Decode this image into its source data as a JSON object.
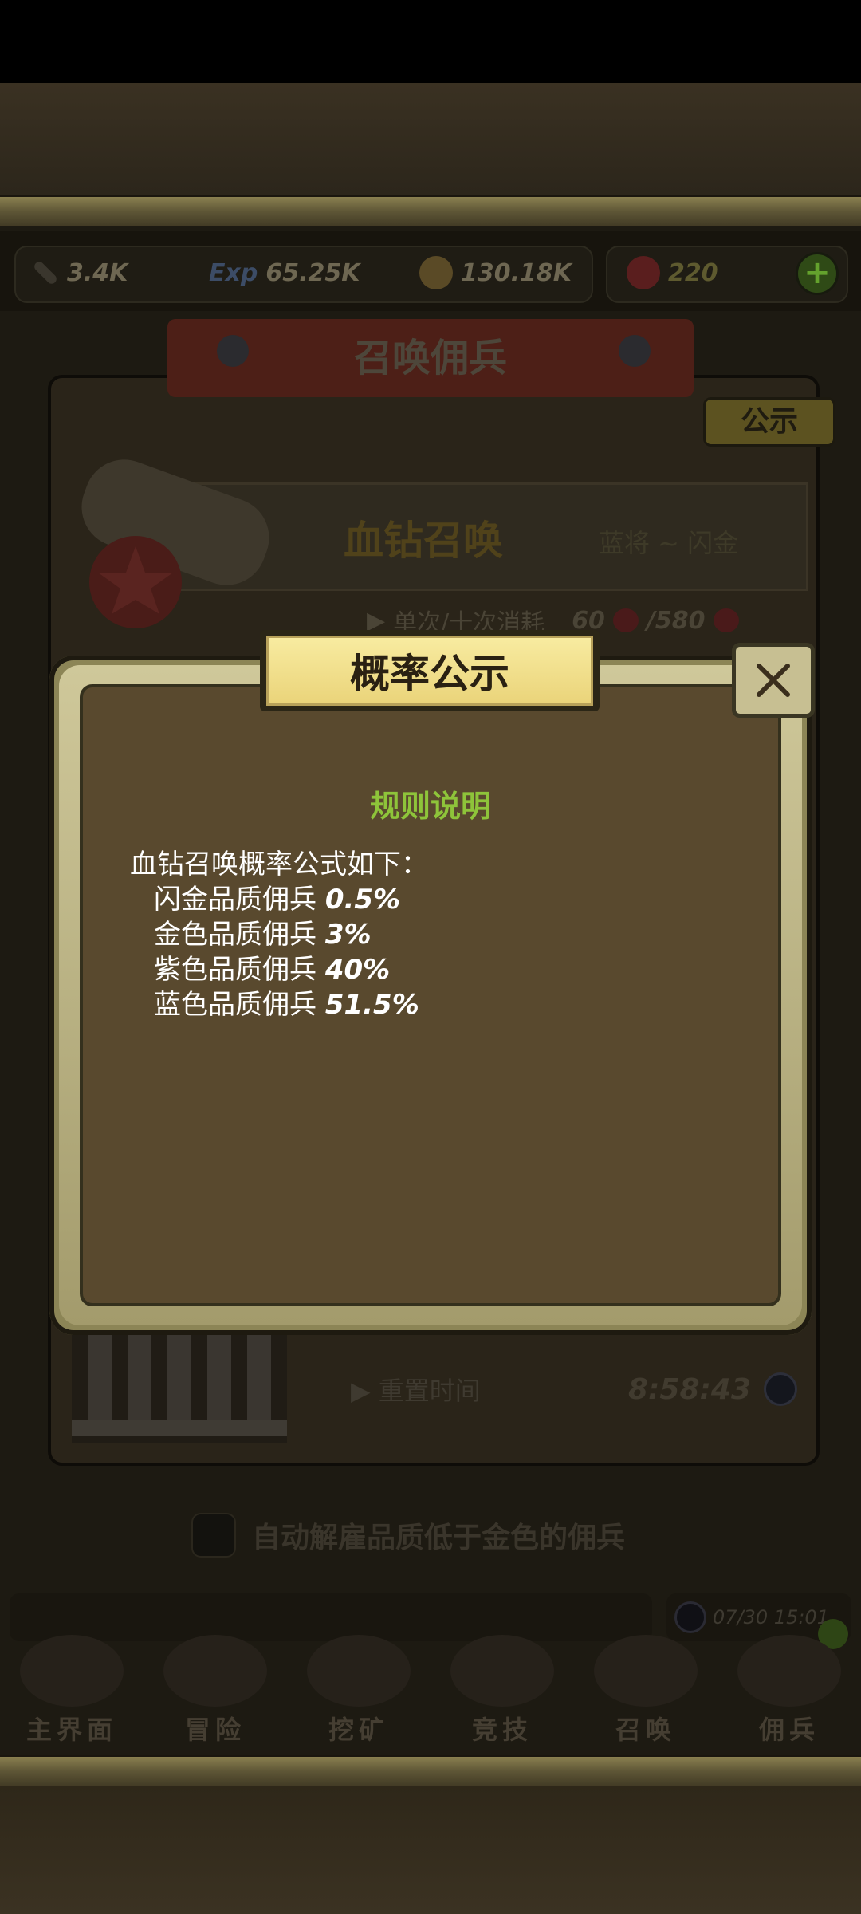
{
  "resources": [
    {
      "icon": "sword-icon",
      "value": "3.4K"
    },
    {
      "icon": "exp-icon",
      "value": "65.25K"
    },
    {
      "icon": "coin-icon",
      "value": "130.18K"
    },
    {
      "icon": "red-diamond-icon",
      "value": "220"
    }
  ],
  "background": {
    "banner_title": "召唤佣兵",
    "notice_button": "公示",
    "card_title": "血钻召唤",
    "card_range": "蓝将 ~ 闪金",
    "cost_label": "单次/十次消耗",
    "cost_single": "60",
    "cost_ten": "/580",
    "reset_label": "重置时间",
    "reset_time": "8:58:43",
    "auto_dismiss_label": "自动解雇品质低于金色的佣兵",
    "clock_time": "07/30 15:01"
  },
  "nav": [
    {
      "label": "主界面",
      "icon": "map-scroll-icon"
    },
    {
      "label": "冒险",
      "icon": "island-icon"
    },
    {
      "label": "挖矿",
      "icon": "pickaxe-lock-icon"
    },
    {
      "label": "竞技",
      "icon": "swords-lock-icon"
    },
    {
      "label": "召唤",
      "icon": "summon-scroll-icon"
    },
    {
      "label": "佣兵",
      "icon": "mercenary-icon"
    }
  ],
  "modal": {
    "title": "概率公示",
    "subtitle": "规则说明",
    "intro": "血钻召唤概率公式如下：",
    "rates": [
      {
        "quality": "闪金品质佣兵",
        "rate": "0.5%"
      },
      {
        "quality": "金色品质佣兵",
        "rate": "3%"
      },
      {
        "quality": "紫色品质佣兵",
        "rate": "40%"
      },
      {
        "quality": "蓝色品质佣兵",
        "rate": "51.5%"
      }
    ]
  },
  "colors": {
    "subtitle": "#8ec43a",
    "modal_bg": "#59492e",
    "title_plate": "#f3e392"
  }
}
